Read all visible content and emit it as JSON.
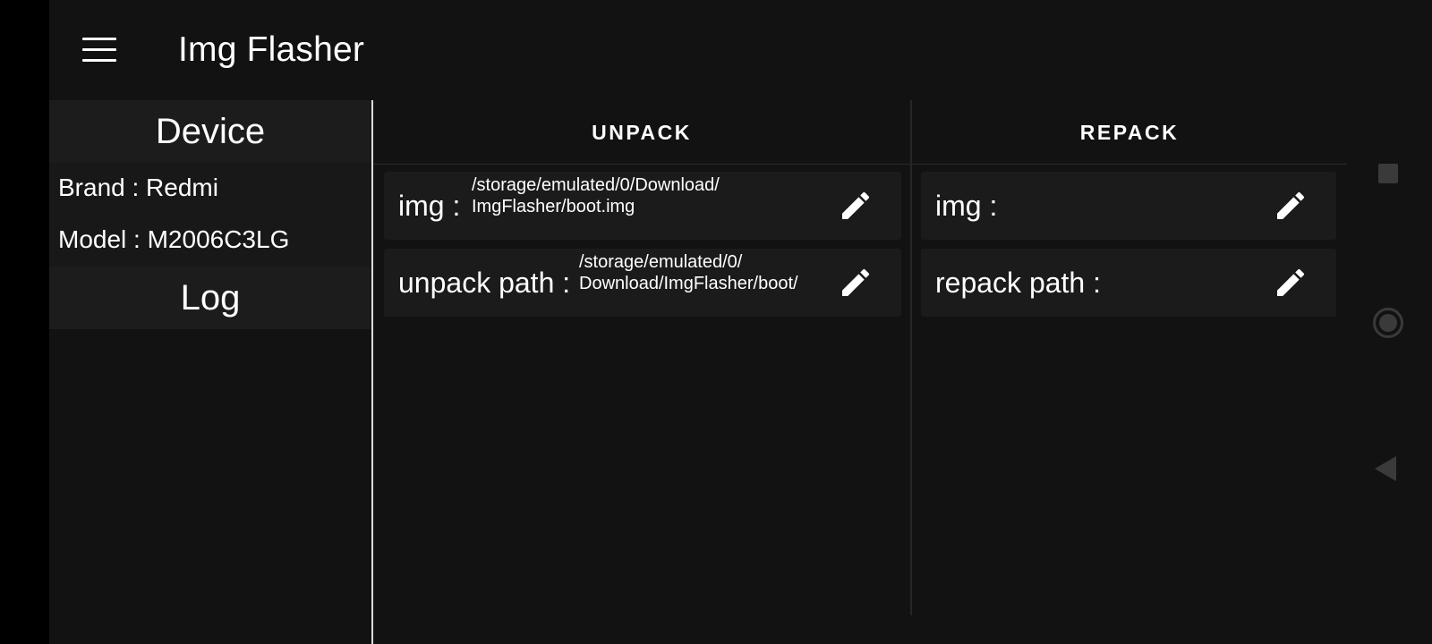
{
  "app": {
    "title": "Img Flasher"
  },
  "device": {
    "header": "Device",
    "brand": "Brand : Redmi",
    "model": "Model : M2006C3LG"
  },
  "log": {
    "header": "Log"
  },
  "tabs": {
    "unpack": "UNPACK",
    "repack": "REPACK"
  },
  "unpack": {
    "img_label": "img :",
    "img_value_line1": "/storage/emulated/0/Download/",
    "img_value_line2": "ImgFlasher/boot.img",
    "path_label": "unpack path :",
    "path_value_line1": "/storage/emulated/0/",
    "path_value_line2": "Download/ImgFlasher/boot/"
  },
  "repack": {
    "img_label": "img :",
    "path_label": "repack path :"
  },
  "icons": {
    "menu": "hamburger-menu-icon",
    "edit": "pencil-edit-icon",
    "nav_recents": "square-icon",
    "nav_home": "circle-icon",
    "nav_back": "triangle-back-icon"
  },
  "colors": {
    "background": "#121212",
    "header_bg": "#1c1c1c",
    "card_bg": "#1b1b1b",
    "text": "#ffffff"
  }
}
